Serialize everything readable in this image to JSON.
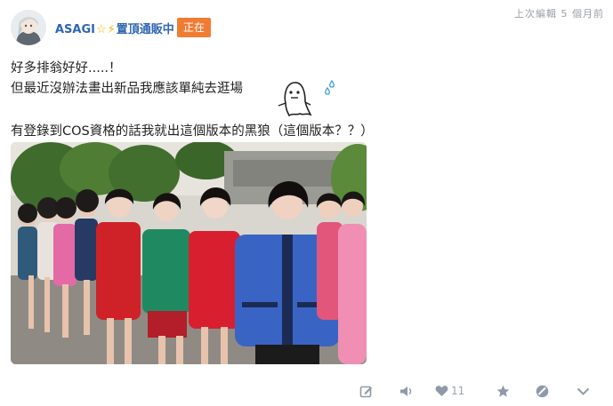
{
  "header": {
    "username": "ASAGI",
    "username_suffix": "置頂通販中",
    "live_badge": "正在",
    "edited": "上次編輯 5 個月前"
  },
  "content": {
    "line1": "好多排翁好好.....！",
    "line2": "但最近沒辦法畫出新品我應該單純去逛場",
    "line3": "有登錄到COS資格的話我就出這個版本的黑狼（這個版本？？）"
  },
  "actions": {
    "like_count": "11"
  },
  "colors": {
    "username": "#2f66b3",
    "badge": "#f07c34",
    "icon": "#8f9aa8"
  },
  "icons": [
    "edit-icon",
    "speaker-icon",
    "heart-icon",
    "star-icon",
    "block-icon",
    "chevron-down-icon"
  ]
}
